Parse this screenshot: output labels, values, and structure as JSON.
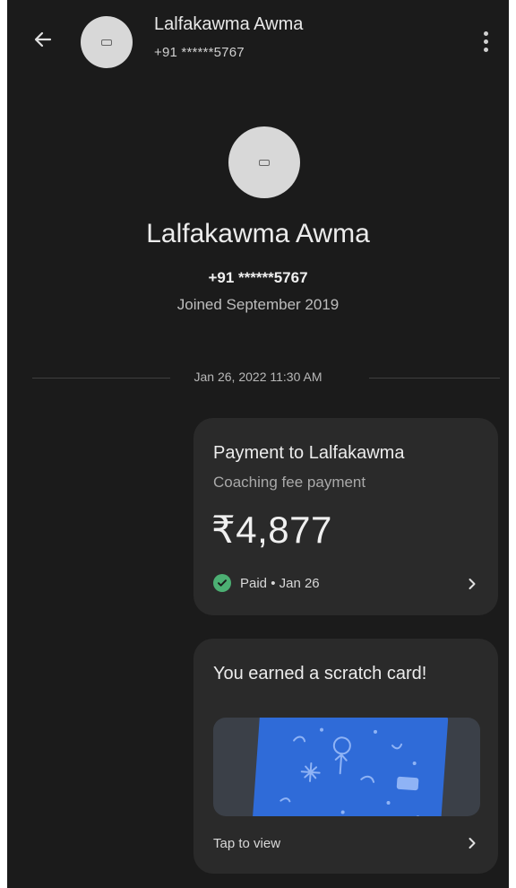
{
  "header": {
    "name": "Lalfakawma Awma",
    "phone": "+91 ******5767"
  },
  "profile": {
    "name": "Lalfakawma Awma",
    "phone": "+91 ******5767",
    "joined": "Joined September 2019"
  },
  "timeline": {
    "date": "Jan 26, 2022 11:30 AM"
  },
  "payment_card": {
    "title": "Payment to Lalfakawma",
    "note": "Coaching fee payment",
    "amount": "₹4,877",
    "status": "Paid • Jan 26",
    "status_color": "#4caf73"
  },
  "scratch_card": {
    "title": "You earned a scratch card!",
    "action": "Tap to view",
    "card_color": "#2f6bd8"
  },
  "icons": [
    "arrow-left-icon",
    "more-vert-icon",
    "check-circle-icon",
    "chevron-right-icon",
    "scratch-card-icon"
  ]
}
